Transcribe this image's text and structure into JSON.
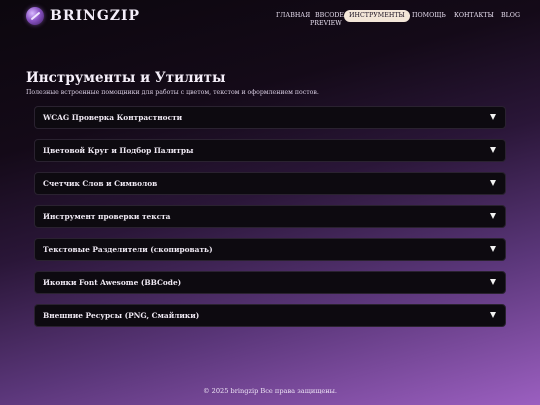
{
  "header": {
    "logo_text": "BRINGZIP",
    "nav": [
      {
        "label": "ГЛАВНАЯ",
        "name": "nav-home",
        "active": false
      },
      {
        "label": "BBCODE",
        "name": "nav-bbcode",
        "active": false
      },
      {
        "label": "PREVIEW",
        "name": "nav-preview",
        "active": false
      },
      {
        "label": "ИНСТРУМЕНТЫ",
        "name": "nav-tools",
        "active": true
      },
      {
        "label": "ПОМОЩЬ",
        "name": "nav-help",
        "active": false
      },
      {
        "label": "КОНТАКТЫ",
        "name": "nav-contacts",
        "active": false
      },
      {
        "label": "BLOG",
        "name": "nav-blog",
        "active": false
      }
    ]
  },
  "main": {
    "title": "Инструменты и Утилиты",
    "subtitle": "Полезные встроенные помощники для работы с цветом, текстом и оформлением постов.",
    "sections": [
      {
        "label": "WCAG Проверка Контрастности"
      },
      {
        "label": "Цветовой Круг и Подбор Палитры"
      },
      {
        "label": "Счетчик Слов и Символов"
      },
      {
        "label": "Инструмент проверки текста"
      },
      {
        "label": "Текстовые Разделители (скопировать)"
      },
      {
        "label": "Иконки Font Awesome (BBCode)"
      },
      {
        "label": "Внешние Ресурсы (PNG, Смайлики)"
      }
    ]
  },
  "footer": {
    "text": "© 2025 bringzip Все права защищены."
  }
}
